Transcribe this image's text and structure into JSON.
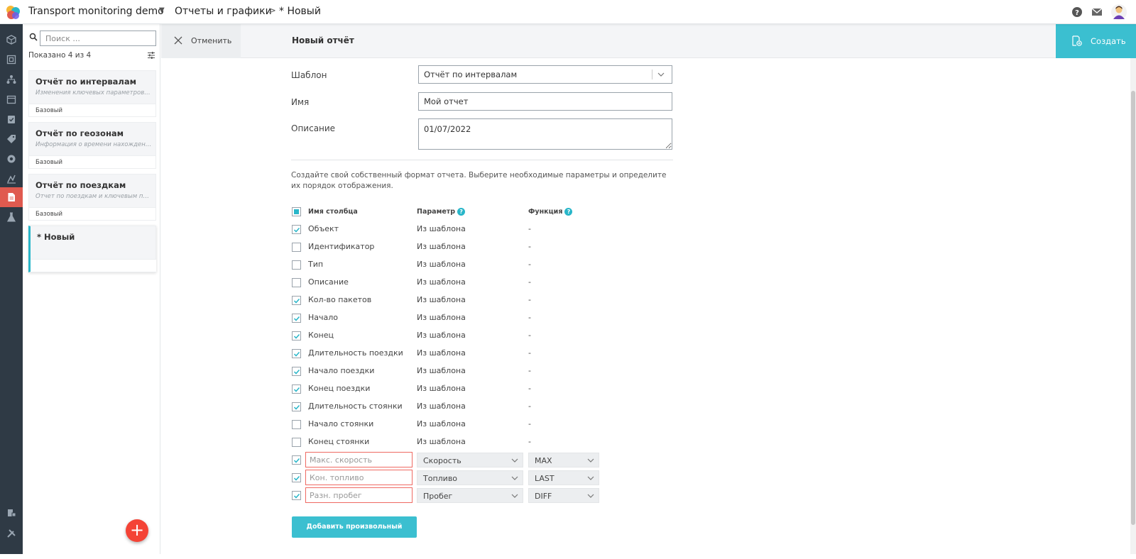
{
  "header": {
    "app_title": "Transport monitoring demo",
    "breadcrumb_section": "Отчеты и графики",
    "breadcrumb_separator": ">",
    "breadcrumb_current": "* Новый"
  },
  "sidebar": {
    "search_placeholder": "Поиск ...",
    "shown_prefix": "Показано",
    "shown_count": "4",
    "shown_of": "из",
    "shown_total": "4",
    "cards": [
      {
        "title": "Отчёт по интервалам",
        "description": "Изменения ключевых параметров ТС",
        "tag": "Базовый"
      },
      {
        "title": "Отчёт по геозонам",
        "description": "Информация о времени нахождения...",
        "tag": "Базовый"
      },
      {
        "title": "Отчёт по поездкам",
        "description": "Отчет по поездкам и ключевым пара...",
        "tag": "Базовый"
      },
      {
        "title": "* Новый"
      }
    ]
  },
  "actionbar": {
    "cancel_label": "Отменить",
    "form_title": "Новый отчёт",
    "create_label": "Создать"
  },
  "form": {
    "template_label": "Шаблон",
    "template_value": "Отчёт по интервалам",
    "name_label": "Имя",
    "name_value": "Мой отчет",
    "description_label": "Описание",
    "description_value": "01/07/2022",
    "help_text": "Создайте свой собственный формат отчета. Выберите необходимые параметры и определите их порядок отображения."
  },
  "columns": {
    "header_name": "Имя столбца",
    "header_param": "Параметр",
    "header_func": "Функция",
    "rows": [
      {
        "name": "Объект",
        "param": "Из шаблона",
        "func": "-",
        "checked": true
      },
      {
        "name": "Идентификатор",
        "param": "Из шаблона",
        "func": "-",
        "checked": false
      },
      {
        "name": "Тип",
        "param": "Из шаблона",
        "func": "-",
        "checked": false
      },
      {
        "name": "Описание",
        "param": "Из шаблона",
        "func": "-",
        "checked": false
      },
      {
        "name": "Кол-во пакетов",
        "param": "Из шаблона",
        "func": "-",
        "checked": true
      },
      {
        "name": "Начало",
        "param": "Из шаблона",
        "func": "-",
        "checked": true
      },
      {
        "name": "Конец",
        "param": "Из шаблона",
        "func": "-",
        "checked": true
      },
      {
        "name": "Длительность поездки",
        "param": "Из шаблона",
        "func": "-",
        "checked": true
      },
      {
        "name": "Начало поездки",
        "param": "Из шаблона",
        "func": "-",
        "checked": true
      },
      {
        "name": "Конец поездки",
        "param": "Из шаблона",
        "func": "-",
        "checked": true
      },
      {
        "name": "Длительность стоянки",
        "param": "Из шаблона",
        "func": "-",
        "checked": true
      },
      {
        "name": "Начало стоянки",
        "param": "Из шаблона",
        "func": "-",
        "checked": false
      },
      {
        "name": "Конец стоянки",
        "param": "Из шаблона",
        "func": "-",
        "checked": false
      }
    ],
    "custom": [
      {
        "placeholder": "Макс. скорость",
        "param": "Скорость",
        "func": "MAX",
        "checked": true
      },
      {
        "placeholder": "Кон. топливо",
        "param": "Топливо",
        "func": "LAST",
        "checked": true
      },
      {
        "placeholder": "Разн. пробег",
        "param": "Пробег",
        "func": "DIFF",
        "checked": true
      }
    ],
    "add_button_label": "Добавить произвольный столбец"
  },
  "colors": {
    "accent": "#3bbfd0",
    "active_nav": "#e05a4f",
    "fab": "#f44336",
    "error_border": "#ef6a63",
    "nav_bg": "#2f3a45"
  },
  "icons": [
    "logo-icon",
    "help-icon",
    "mail-icon",
    "user-avatar-icon",
    "box-icon",
    "layers-icon",
    "hierarchy-icon",
    "calendar-icon",
    "task-icon",
    "tag-icon",
    "settings-icon",
    "route-icon",
    "report-icon",
    "flask-icon",
    "shield-lock-icon",
    "tools-icon",
    "search-icon",
    "filter-icon",
    "close-icon",
    "create-report-icon",
    "chevron-down-icon",
    "question-icon",
    "plus-icon"
  ]
}
